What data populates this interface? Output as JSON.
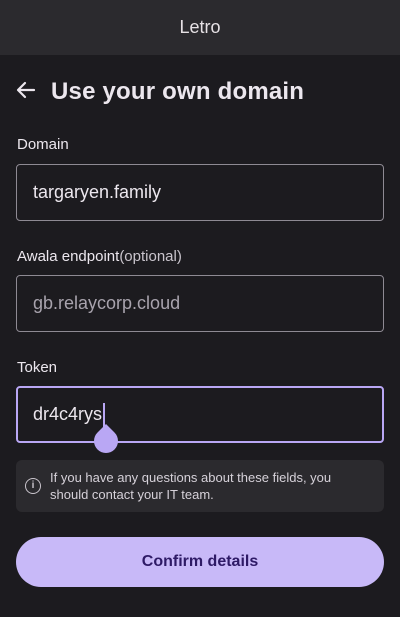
{
  "app_bar": {
    "title": "Letro"
  },
  "header": {
    "title": "Use your own domain",
    "back_icon": "arrow-left-icon"
  },
  "domain": {
    "label": "Domain",
    "value": "targaryen.family"
  },
  "awala_endpoint": {
    "label": "Awala endpoint",
    "optional": "(optional)",
    "placeholder": "gb.relaycorp.cloud"
  },
  "token": {
    "label": "Token",
    "value": "dr4c4rys"
  },
  "info": {
    "icon": "info-icon",
    "text": "If you have any questions about these fields, you should contact your IT team."
  },
  "confirm": {
    "label": "Confirm details"
  },
  "colors": {
    "accent": "#b9a7f4",
    "button": "#c8b9f8",
    "background": "#1c1b1f"
  }
}
